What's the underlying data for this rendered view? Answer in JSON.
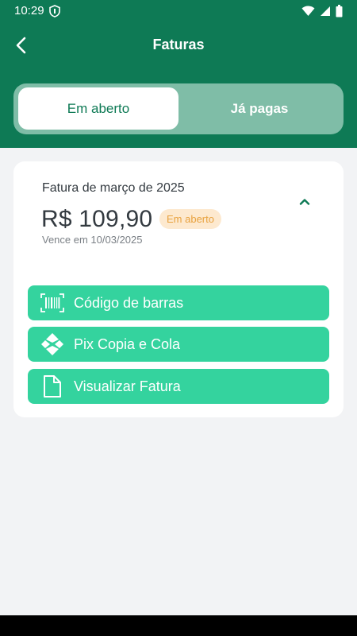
{
  "status_bar": {
    "time": "10:29",
    "icons": [
      "shield-icon",
      "wifi-icon",
      "signal-icon",
      "battery-icon"
    ]
  },
  "header": {
    "title": "Faturas",
    "back_icon": "chevron-left-icon"
  },
  "tabs": [
    {
      "label": "Em aberto",
      "selected": true
    },
    {
      "label": "Já pagas",
      "selected": false
    }
  ],
  "invoice": {
    "title": "Fatura de março de 2025",
    "amount": "R$ 109,90",
    "status": "Em aberto",
    "due": "Vence em 10/03/2025",
    "expand_icon": "chevron-up-icon"
  },
  "actions": [
    {
      "label": "Código de barras",
      "icon": "barcode-icon"
    },
    {
      "label": "Pix Copia e Cola",
      "icon": "pix-icon"
    },
    {
      "label": "Visualizar Fatura",
      "icon": "document-icon"
    }
  ],
  "colors": {
    "primary": "#0e7a55",
    "segment_bg": "#7fbda7",
    "action": "#34d39e",
    "badge_bg": "#fde9cf",
    "badge_text": "#e8a23f",
    "background": "#f2f3f5"
  }
}
